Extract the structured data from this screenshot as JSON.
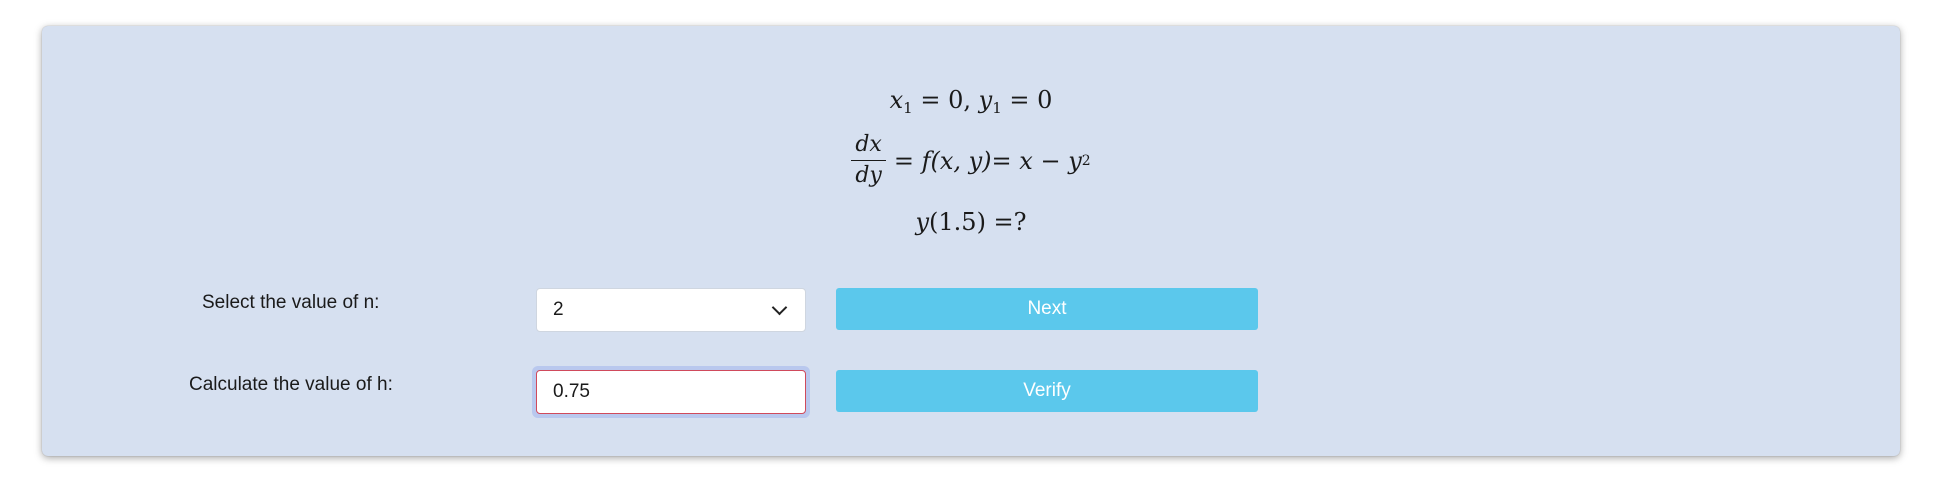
{
  "problem": {
    "line1": {
      "x_var": "x",
      "x_sub": "1",
      "x_eq": " = 0, ",
      "y_var": "y",
      "y_sub": "1",
      "y_eq": " = 0"
    },
    "line2": {
      "frac_num": "dx",
      "frac_den": "dy",
      "eq_a": "= ",
      "f": "f",
      "args": "(x, y)",
      "eq_b": " = x − y",
      "exp": "2"
    },
    "line3": {
      "y": "y",
      "arg": "(1.5) =?"
    }
  },
  "form": {
    "n_label": "Select the value of n:",
    "n_selected": "2",
    "h_label": "Calculate the value of h:",
    "h_value": "0.75",
    "next_label": "Next",
    "verify_label": "Verify"
  },
  "colors": {
    "card_bg": "#d6e0f0",
    "button_bg": "#5bc8ec",
    "invalid_border": "#d04a5c",
    "focus_ring": "#b9c8ee"
  },
  "icons": {
    "select_arrow": "chevron-down-icon"
  }
}
